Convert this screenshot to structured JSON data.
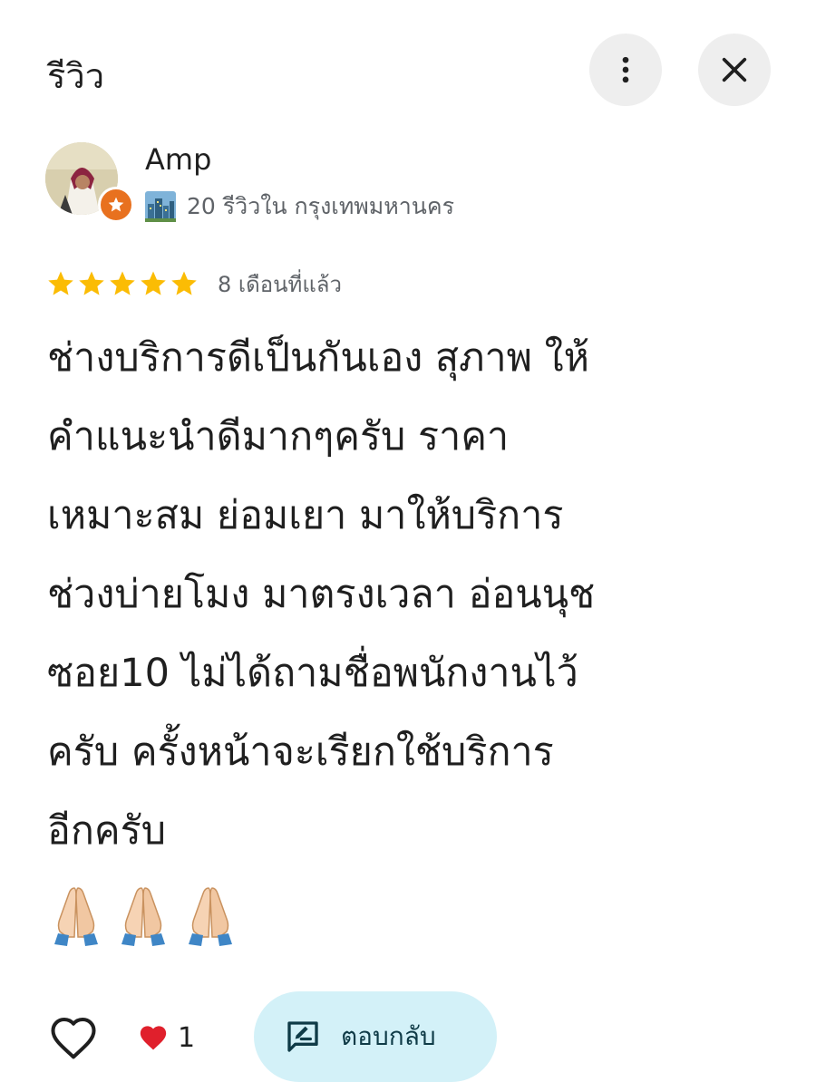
{
  "header": {
    "title": "รีวิว",
    "more_icon": "more-vert-icon",
    "close_icon": "close-icon"
  },
  "author": {
    "name": "Amp",
    "meta_count": "20 รีวิวใน กรุงเทพมหานคร",
    "badge_icon": "local-guide-star-icon",
    "meta_icon": "cityscape-icon",
    "badge_color": "#e8711f"
  },
  "rating": {
    "stars": 5,
    "date": "8 เดือนที่แล้ว",
    "star_color": "#fbbc04"
  },
  "review": {
    "lines": [
      "ช่างบริการดีเป็นกันเอง สุภาพ ให้",
      "คำแนะนำดีมากๆครับ ราคา",
      "เหมาะสม ย่อมเยา มาให้บริการ",
      "ช่วงบ่ายโมง มาตรงเวลา อ่อนนุช",
      "ซอย10 ไม่ได้ถามชื่อพนักงานไว้",
      "ครับ ครั้งหน้าจะเรียกใช้บริการ",
      "อีกครับ"
    ],
    "emoji_icons": [
      "folded-hands-icon",
      "folded-hands-icon",
      "folded-hands-icon"
    ]
  },
  "actions": {
    "like_icon": "heart-outline-icon",
    "reaction_icon": "red-heart-icon",
    "reaction_count": "1",
    "reply_label": "ตอบกลับ",
    "reply_icon": "edit-reply-icon",
    "reply_bg": "#d3f1f8"
  }
}
